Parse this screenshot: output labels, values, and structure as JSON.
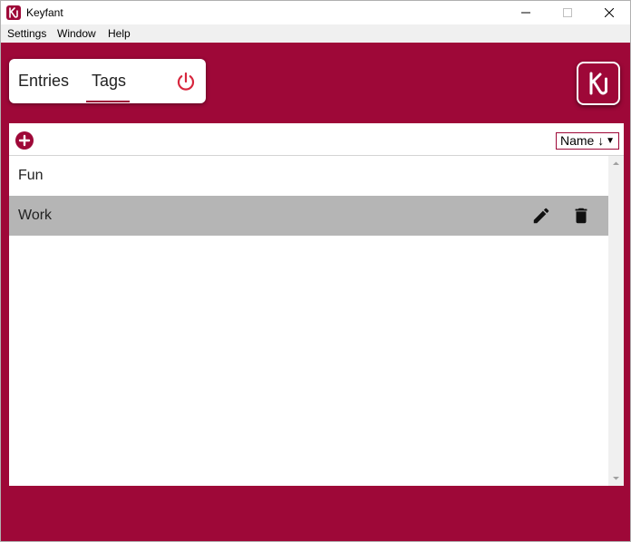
{
  "window": {
    "title": "Keyfant"
  },
  "menu": {
    "items": [
      {
        "label": "Settings"
      },
      {
        "label": "Window"
      },
      {
        "label": "Help"
      }
    ]
  },
  "nav": {
    "tabs": [
      {
        "label": "Entries",
        "active": false
      },
      {
        "label": "Tags",
        "active": true
      }
    ]
  },
  "toolbar": {
    "sort_label": "Name ↓",
    "sort_arrow": "▼"
  },
  "tags": [
    {
      "name": "Fun",
      "selected": false
    },
    {
      "name": "Work",
      "selected": true
    }
  ],
  "colors": {
    "brand": "#9e0838",
    "selected_row": "#b5b5b5",
    "power_icon": "#d7263d"
  },
  "icons": {
    "power": "power-icon",
    "logo": "keyfant-logo",
    "add": "add-circle-icon",
    "edit": "pencil-icon",
    "delete": "trash-icon"
  }
}
